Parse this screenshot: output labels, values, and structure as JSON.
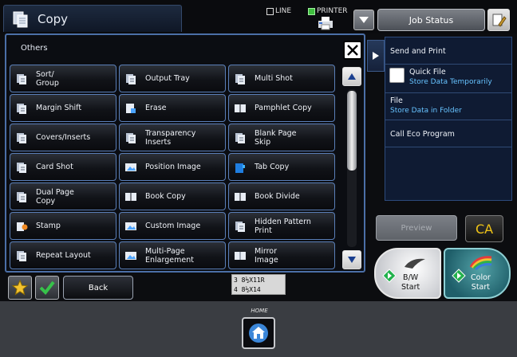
{
  "header": {
    "title": "Copy",
    "line_label": "LINE",
    "printer_label": "PRINTER",
    "job_status": "Job Status"
  },
  "panel": {
    "title": "Others",
    "options": [
      {
        "label": "Sort/\nGroup",
        "icon": "sort-group-icon"
      },
      {
        "label": "Output Tray",
        "icon": "output-tray-icon"
      },
      {
        "label": "Multi Shot",
        "icon": "multi-shot-icon"
      },
      {
        "label": "Margin Shift",
        "icon": "margin-shift-icon"
      },
      {
        "label": "Erase",
        "icon": "erase-icon"
      },
      {
        "label": "Pamphlet Copy",
        "icon": "pamphlet-copy-icon"
      },
      {
        "label": "Covers/Inserts",
        "icon": "covers-inserts-icon"
      },
      {
        "label": "Transparency\nInserts",
        "icon": "transparency-inserts-icon"
      },
      {
        "label": "Blank Page\nSkip",
        "icon": "blank-page-skip-icon"
      },
      {
        "label": "Card Shot",
        "icon": "card-shot-icon"
      },
      {
        "label": "Position Image",
        "icon": "position-image-icon"
      },
      {
        "label": "Tab Copy",
        "icon": "tab-copy-icon"
      },
      {
        "label": "Dual Page\nCopy",
        "icon": "dual-page-copy-icon"
      },
      {
        "label": "Book Copy",
        "icon": "book-copy-icon"
      },
      {
        "label": "Book Divide",
        "icon": "book-divide-icon"
      },
      {
        "label": "Stamp",
        "icon": "stamp-icon"
      },
      {
        "label": "Custom Image",
        "icon": "custom-image-icon"
      },
      {
        "label": "Hidden Pattern\nPrint",
        "icon": "hidden-pattern-print-icon"
      },
      {
        "label": "Repeat Layout",
        "icon": "repeat-layout-icon"
      },
      {
        "label": "Multi-Page\nEnlargement",
        "icon": "multi-page-enlargement-icon"
      },
      {
        "label": "Mirror\nImage",
        "icon": "mirror-image-icon"
      }
    ]
  },
  "footer": {
    "back_label": "Back",
    "tray_line1": "3 8½X11R",
    "tray_line2": "4 8½X14"
  },
  "sidebar": {
    "send_and_print": "Send and Print",
    "quick_file": "Quick File",
    "quick_file_sub": "Store Data Temporarily",
    "file": "File",
    "file_sub": "Store Data in Folder",
    "eco": "Call Eco Program"
  },
  "actions": {
    "preview": "Preview",
    "ca": "CA",
    "bw_start": "B/W\nStart",
    "color_start": "Color\nStart"
  },
  "home_label": "HOME",
  "colors": {
    "accent_blue": "#4b6fa7",
    "link_blue": "#67c3ff",
    "ca_yellow": "#f0c416",
    "start_green": "#22b14c"
  }
}
